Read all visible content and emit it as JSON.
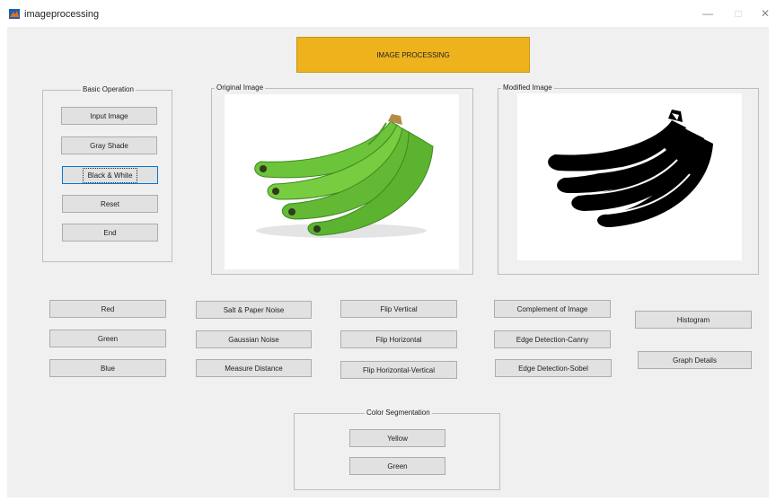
{
  "window": {
    "title": "imageprocessing",
    "minimize_glyph": "—",
    "maximize_glyph": "□",
    "close_glyph": "✕"
  },
  "header": {
    "label": "IMAGE PROCESSING",
    "color": "#eeb21d"
  },
  "basic_operation": {
    "title": "Basic Operation",
    "buttons": [
      "Input Image",
      "Gray Shade",
      "Black & White",
      "Reset",
      "End"
    ]
  },
  "original_image": {
    "title": "Original Image"
  },
  "modified_image": {
    "title": "Modified Image"
  },
  "color_buttons": [
    "Red",
    "Green",
    "Blue"
  ],
  "noise_buttons": [
    "Salt & Paper Noise",
    "Gaussian Noise",
    "Measure Distance"
  ],
  "flip_buttons": [
    "Flip Vertical",
    "Flip Horizontal",
    "Flip Horizontal-Vertical"
  ],
  "edge_buttons": [
    "Complement of Image",
    "Edge Detection-Canny",
    "Edge Detection-Sobel"
  ],
  "analysis_buttons": [
    "Histogram",
    "Graph Details"
  ],
  "color_segmentation": {
    "title": "Color Segmentation",
    "buttons": [
      "Yellow",
      "Green"
    ]
  },
  "colors": {
    "window_bg": "#f0f0f0",
    "button_bg": "#e1e1e1",
    "focus_border": "#0078d7",
    "banana_green": "#6cc43a"
  }
}
